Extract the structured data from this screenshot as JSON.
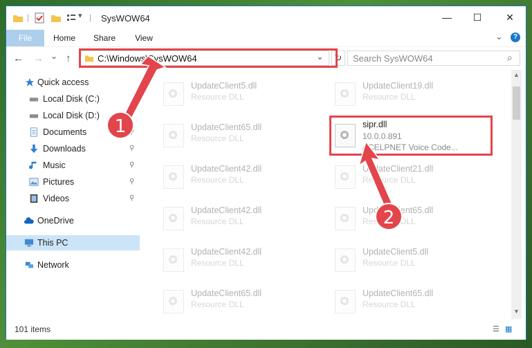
{
  "window": {
    "title": "SysWOW64",
    "minimize": "—",
    "maximize": "☐",
    "close": "✕"
  },
  "ribbon": {
    "tabs": [
      "File",
      "Home",
      "Share",
      "View"
    ],
    "expand": "⌄",
    "help": "?"
  },
  "nav": {
    "back": "←",
    "forward": "→",
    "recent": "⌄",
    "up": "↑",
    "address": "C:\\Windows\\SysWOW64",
    "address_dropdown": "⌄",
    "refresh": "↻",
    "search_placeholder": "Search SysWOW64",
    "search_icon": "⌕"
  },
  "sidebar": {
    "items": [
      {
        "label": "Quick access",
        "icon": "star-icon",
        "pinned": false
      },
      {
        "label": "Local Disk (C:)",
        "icon": "drive-icon",
        "pinned": false
      },
      {
        "label": "Local Disk (D:)",
        "icon": "drive-icon",
        "pinned": true
      },
      {
        "label": "Documents",
        "icon": "documents-icon",
        "pinned": true
      },
      {
        "label": "Downloads",
        "icon": "download-icon",
        "pinned": true
      },
      {
        "label": "Music",
        "icon": "music-icon",
        "pinned": true
      },
      {
        "label": "Pictures",
        "icon": "pictures-icon",
        "pinned": true
      },
      {
        "label": "Videos",
        "icon": "videos-icon",
        "pinned": true
      },
      {
        "label": "OneDrive",
        "icon": "cloud-icon",
        "pinned": false
      },
      {
        "label": "This PC",
        "icon": "computer-icon",
        "pinned": false
      },
      {
        "label": "Network",
        "icon": "network-icon",
        "pinned": false
      }
    ],
    "pin_glyph": "📌"
  },
  "files": {
    "left": [
      {
        "name": "UpdateClient5.dll",
        "type": "Resource DLL"
      },
      {
        "name": "UpdateClient65.dll",
        "type": "Resource DLL"
      },
      {
        "name": "UpdateClient42.dll",
        "type": "Resource DLL"
      },
      {
        "name": "UpdateClient42.dll",
        "type": "Resource DLL"
      },
      {
        "name": "UpdateClient42.dll",
        "type": "Resource DLL"
      },
      {
        "name": "UpdateClient65.dll",
        "type": "Resource DLL"
      }
    ],
    "right": [
      {
        "name": "UpdateClient19.dll",
        "type": "Resource DLL"
      },
      {
        "name": "UpdateClient21.dll",
        "type": "Resource DLL"
      },
      {
        "name": "UpdateClient65.dll",
        "type": "Resource DLL"
      },
      {
        "name": "UpdateClient5.dll",
        "type": "Resource DLL"
      },
      {
        "name": "UpdateClient65.dll",
        "type": "Resource DLL"
      }
    ],
    "highlighted": {
      "name": "sipr.dll",
      "version": "10.0.0.891",
      "description": "ACELPNET Voice Code..."
    }
  },
  "status": {
    "items": "101 items"
  },
  "callouts": [
    "1",
    "2"
  ],
  "colors": {
    "accent": "#1979ca",
    "callout": "#e2454b",
    "selected": "#cce4f7"
  }
}
